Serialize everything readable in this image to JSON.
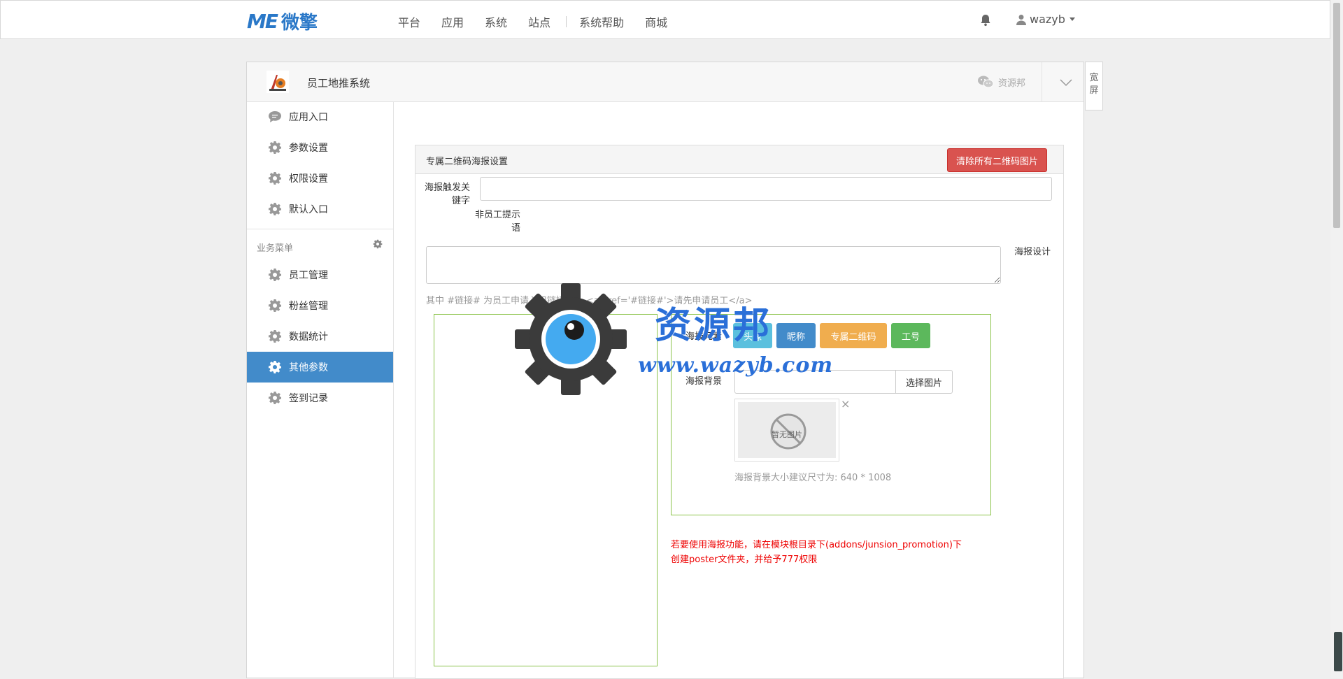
{
  "topbar": {
    "logo_mark": "ME",
    "logo_text": "微擎",
    "nav": [
      "平台",
      "应用",
      "系统",
      "站点",
      "系统帮助",
      "商城"
    ],
    "username": "wazyb"
  },
  "app": {
    "title": "员工地推系统",
    "wechat_label": "资源邦",
    "wide_label": "宽屏"
  },
  "sidebar": {
    "items_top": [
      {
        "label": "应用入口",
        "icon": "chat-bubble-icon"
      },
      {
        "label": "参数设置",
        "icon": "gear-icon"
      },
      {
        "label": "权限设置",
        "icon": "gear-icon"
      },
      {
        "label": "默认入口",
        "icon": "gear-icon"
      }
    ],
    "section_label": "业务菜单",
    "items_business": [
      {
        "label": "员工管理",
        "icon": "gear-icon"
      },
      {
        "label": "粉丝管理",
        "icon": "gear-icon"
      },
      {
        "label": "数据统计",
        "icon": "gear-icon"
      },
      {
        "label": "其他参数",
        "icon": "gear-icon",
        "active": true
      },
      {
        "label": "签到记录",
        "icon": "gear-icon"
      }
    ]
  },
  "card": {
    "title": "专属二维码海报设置",
    "clear_button": "清除所有二维码图片",
    "keyword_label": "海报触发关键字",
    "keyword_value": "",
    "non_employee_label": "非员工提示语",
    "non_employee_value": "",
    "design_label": "海报设计",
    "hint": "其中 #链接# 为员工申请入口链接, 如: <a href='#链接#'>请先申请员工</a>",
    "elements_label": "海报元素",
    "element_buttons": [
      "头像",
      "昵称",
      "专属二维码",
      "工号"
    ],
    "background_label": "海报背景",
    "background_value": "",
    "select_image": "选择图片",
    "no_image": "暂无图片",
    "remove_mark": "×",
    "size_hint": "海报背景大小建议尺寸为: 640 * 1008",
    "warning_line1": "若要使用海报功能，请在模块根目录下(addons/junsion_promotion)下",
    "warning_line2": "创建poster文件夹，并给予777权限"
  },
  "watermark": {
    "text": "资源邦",
    "url": "www.wazyb.com"
  },
  "colors": {
    "primary": "#428bca",
    "danger": "#d9534f",
    "info": "#5bc0de",
    "warning": "#f0ad4e",
    "success": "#5cb85c",
    "box_border": "#8bc34a",
    "warning_text": "#ee0000"
  }
}
